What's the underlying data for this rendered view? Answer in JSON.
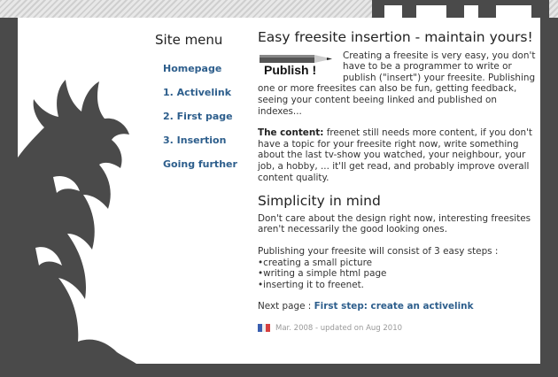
{
  "sidebar": {
    "title": "Site menu",
    "items": [
      "Homepage",
      "1. Activelink",
      "2. First page",
      "3. Insertion",
      "Going further"
    ]
  },
  "main": {
    "title": "Easy freesite insertion - maintain yours!",
    "badge_label": "Publish !",
    "intro": "Creating a freesite is very easy, you don't have to be a programmer to write or publish (\"insert\") your freesite. Publishing one or more freesites can also be fun, getting feedback, seeing your content beeing linked and published on indexes...",
    "content_label": "The content:",
    "content_text": " freenet still needs more content, if you don't have a topic for your freesite right now, write something about the last tv-show you watched, your neighbour, your job, a hobby, ... it'll get read, and probably improve overall content quality.",
    "section2_title": "Simplicity in mind",
    "section2_p1": "Don't care about the design right now, interesting freesites aren't necessarily the good looking ones.",
    "steps_intro": "Publishing your freesite will consist of 3 easy steps :",
    "steps": [
      "creating a small picture",
      "writing a simple html page",
      "inserting it to freenet."
    ],
    "next_label": "Next page : ",
    "next_link": "First step: create an activelink",
    "footer": "Mar. 2008 - updated on Aug 2010"
  },
  "colors": {
    "background": "#4a4a4a",
    "link": "#2d5e8c",
    "dragon": "#4a4a4a"
  },
  "icons": {
    "badge": "pencil-icon",
    "flag": "france-flag-icon",
    "logo": "dragon-logo"
  }
}
